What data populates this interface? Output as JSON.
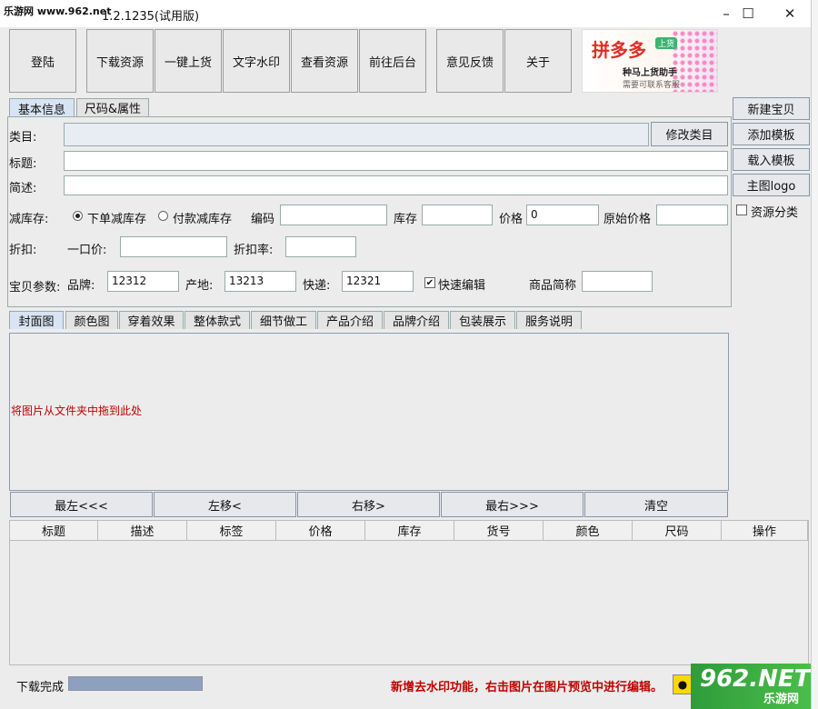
{
  "watermark_top": "乐游网 www.962.net",
  "window": {
    "title": "1.2.1235(试用版)",
    "minimize": "–",
    "maximize": "☐",
    "close": "✕"
  },
  "toolbar": [
    {
      "id": "login",
      "label": "登陆"
    },
    {
      "id": "download",
      "label": "下载资源"
    },
    {
      "id": "upload",
      "label": "一键上货"
    },
    {
      "id": "watermark",
      "label": "文字水印"
    },
    {
      "id": "view",
      "label": "查看资源"
    },
    {
      "id": "backend",
      "label": "前往后台"
    },
    {
      "id": "feedback",
      "label": "意见反馈"
    },
    {
      "id": "about",
      "label": "关于"
    }
  ],
  "ad": {
    "main": "拼多多",
    "badge": "上货",
    "line1": "种马上货助手",
    "line2": "需要可联系客服"
  },
  "top_tabs": [
    "基本信息",
    "尺码&属性"
  ],
  "form": {
    "category_label": "类目:",
    "category_value": "",
    "modify_category": "修改类目",
    "title_label": "标题:",
    "title_value": "",
    "desc_label": "简述:",
    "desc_value": "",
    "stock_mode_label": "减库存:",
    "stock_mode_opt1": "下单减库存",
    "stock_mode_opt2": "付款减库存",
    "code_label": "编码",
    "code_value": "",
    "stock_label": "库存",
    "stock_value": "",
    "price_label": "价格",
    "price_value": "0",
    "orig_price_label": "原始价格",
    "orig_price_value": "",
    "discount_label": "折扣:",
    "fixed_price_label": "一口价:",
    "fixed_price_value": "",
    "discount_rate_label": "折扣率:",
    "discount_rate_value": "",
    "params_label": "宝贝参数:",
    "brand_label": "品牌:",
    "brand_value": "12312",
    "origin_label": "产地:",
    "origin_value": "13213",
    "express_label": "快递:",
    "express_value": "12321",
    "quick_edit_label": "快速编辑",
    "quick_edit_check": "✔",
    "short_name_label": "商品简称",
    "short_name_value": ""
  },
  "right_panel": {
    "new_item": "新建宝贝",
    "add_template": "添加模板",
    "load_template": "载入模板",
    "main_logo": "主图logo",
    "resource_classify": "资源分类"
  },
  "image_tabs": [
    "封面图",
    "颜色图",
    "穿着效果",
    "整体款式",
    "细节做工",
    "产品介绍",
    "品牌介绍",
    "包装展示",
    "服务说明"
  ],
  "drop_hint": "将图片从文件夹中拖到此处",
  "nav_buttons": [
    "最左<<<",
    "左移<",
    "右移>",
    "最右>>>",
    "清空"
  ],
  "table_headers": [
    "标题",
    "描述",
    "标签",
    "价格",
    "库存",
    "货号",
    "颜色",
    "尺码",
    "操作"
  ],
  "status": {
    "text": "下载完成",
    "progress": 1.0,
    "notice": "新增去水印功能，右击图片在图片预览中进行编辑。",
    "qq_icon": "qq-icon"
  },
  "watermark_bottom": {
    "num": "962.NET",
    "txt": "乐游网"
  }
}
